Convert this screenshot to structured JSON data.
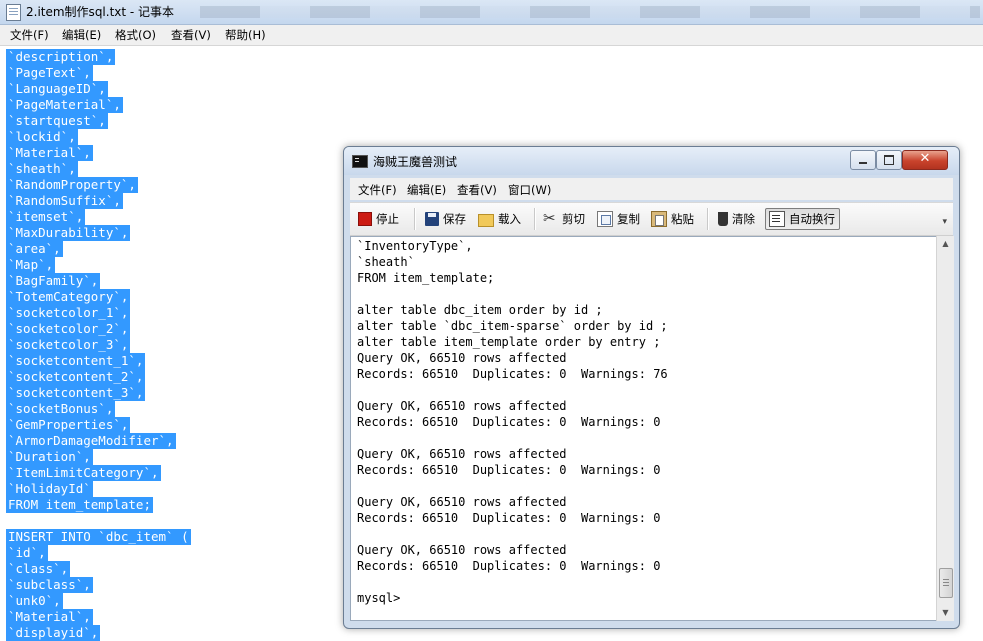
{
  "notepad": {
    "title": "2.item制作sql.txt - 记事本",
    "menu": [
      "文件(F)",
      "编辑(E)",
      "格式(O)",
      "查看(V)",
      "帮助(H)"
    ],
    "lines": [
      "`description`,",
      "`PageText`,",
      "`LanguageID`,",
      "`PageMaterial`,",
      "`startquest`,",
      "`lockid`,",
      "`Material`,",
      "`sheath`,",
      "`RandomProperty`,",
      "`RandomSuffix`,",
      "`itemset`,",
      "`MaxDurability`,",
      "`area`,",
      "`Map`,",
      "`BagFamily`,",
      "`TotemCategory`,",
      "`socketcolor_1`,",
      "`socketcolor_2`,",
      "`socketcolor_3`,",
      "`socketcontent_1`,",
      "`socketcontent_2`,",
      "`socketcontent_3`,",
      "`socketBonus`,",
      "`GemProperties`,",
      "`ArmorDamageModifier`,",
      "`Duration`,",
      "`ItemLimitCategory`,",
      "`HolidayId`",
      "FROM item_template;",
      "",
      "INSERT INTO `dbc_item` (",
      "`id`,",
      "`class`,",
      "`subclass`,",
      "`unk0`,",
      "`Material`,",
      "`displayid`,"
    ]
  },
  "console_window": {
    "title": "海贼王魔兽测试",
    "close_glyph": "✕",
    "menu": [
      "文件(F)",
      "编辑(E)",
      "查看(V)",
      "窗口(W)"
    ],
    "toolbar": {
      "stop": "停止",
      "save": "保存",
      "load": "载入",
      "cut": "剪切",
      "copy": "复制",
      "paste": "粘贴",
      "clear": "清除",
      "auto_wrap": "自动换行"
    },
    "lines": [
      "`InventoryType`,",
      "`sheath`",
      "FROM item_template;",
      "",
      "alter table dbc_item order by id ;",
      "alter table `dbc_item-sparse` order by id ;",
      "alter table item_template order by entry ;",
      "Query OK, 66510 rows affected",
      "Records: 66510  Duplicates: 0  Warnings: 76",
      "",
      "Query OK, 66510 rows affected",
      "Records: 66510  Duplicates: 0  Warnings: 0",
      "",
      "Query OK, 66510 rows affected",
      "Records: 66510  Duplicates: 0  Warnings: 0",
      "",
      "Query OK, 66510 rows affected",
      "Records: 66510  Duplicates: 0  Warnings: 0",
      "",
      "Query OK, 66510 rows affected",
      "Records: 66510  Duplicates: 0  Warnings: 0",
      "",
      "mysql>"
    ]
  },
  "icons": {
    "notepad_app": "notepad-icon",
    "console_app": "console-icon",
    "stop": "stop-icon",
    "save": "save-icon",
    "load": "folder-icon",
    "cut": "scissors-icon",
    "copy": "copy-icon",
    "paste": "paste-icon",
    "clear": "trash-icon",
    "auto_wrap": "word-wrap-icon"
  },
  "colors": {
    "selection_bg": "#3399ff",
    "selection_text": "#ffffff",
    "stop_red": "#cc1b13"
  }
}
